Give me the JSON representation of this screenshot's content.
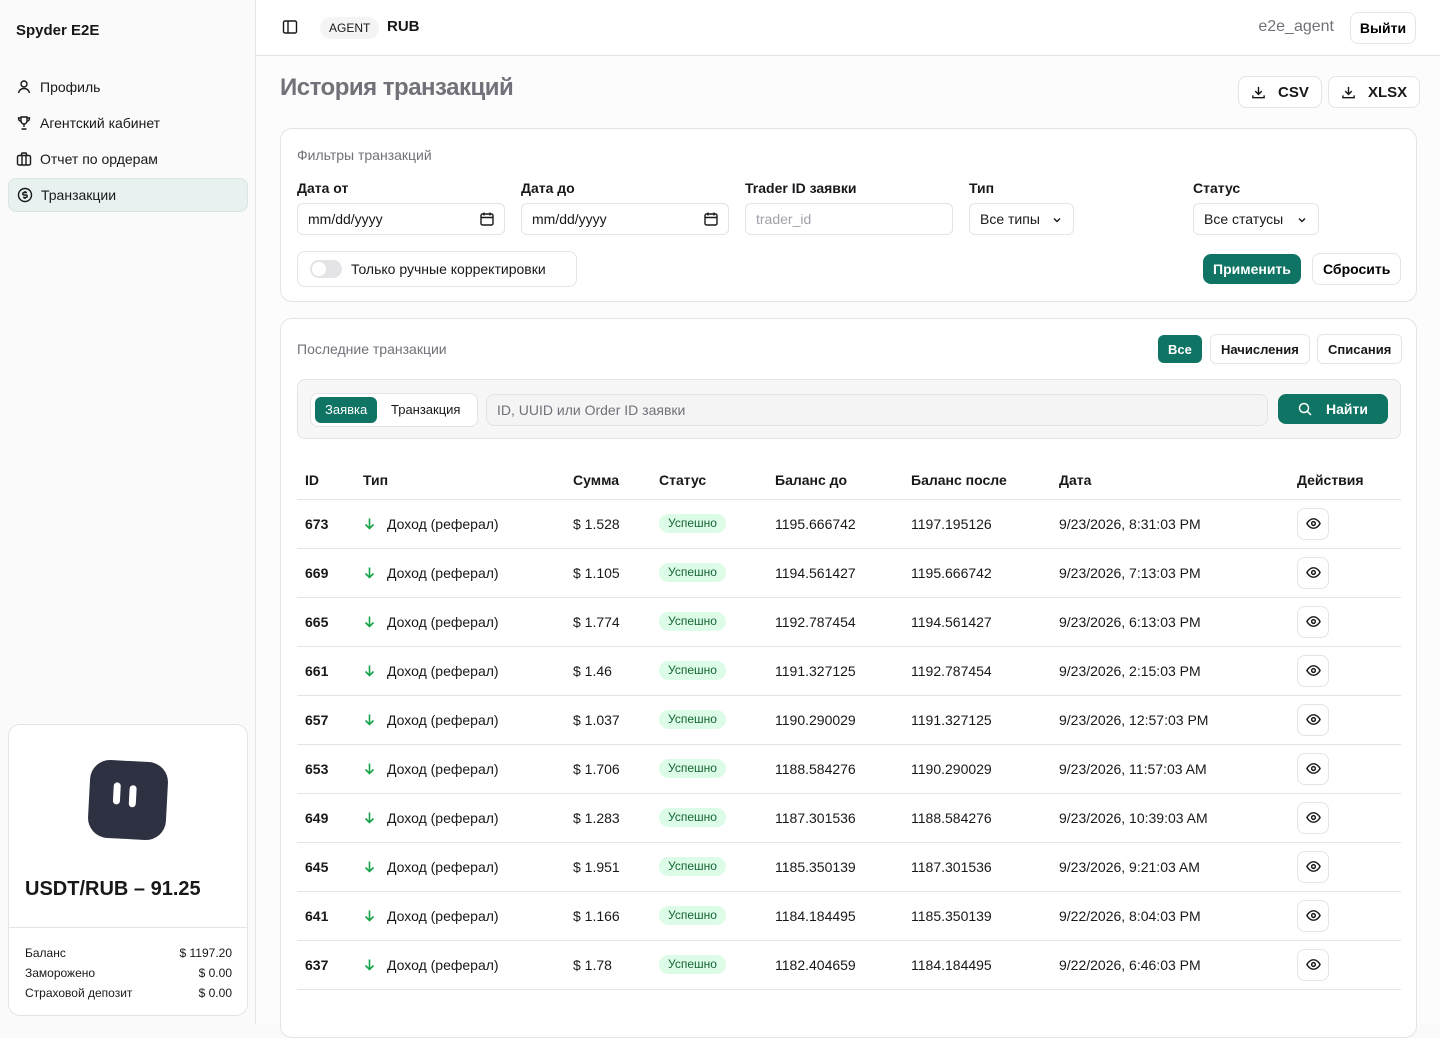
{
  "sidebar": {
    "brand": "Spyder E2E",
    "items": [
      {
        "label": "Профиль"
      },
      {
        "label": "Агентский кабинет"
      },
      {
        "label": "Отчет по ордерам"
      },
      {
        "label": "Транзакции"
      }
    ],
    "card": {
      "rate": "USDT/RUB – 91.25",
      "stats": [
        {
          "label": "Баланс",
          "value": "$ 1197.20"
        },
        {
          "label": "Заморожено",
          "value": "$ 0.00"
        },
        {
          "label": "Страховой депозит",
          "value": "$ 0.00"
        }
      ]
    }
  },
  "header": {
    "role": "AGENT",
    "currency": "RUB",
    "username": "e2e_agent",
    "logout": "Выйти"
  },
  "page": {
    "title": "История транзакций",
    "export_csv": "CSV",
    "export_xlsx": "XLSX"
  },
  "filters": {
    "title": "Фильтры транзакций",
    "date_from_label": "Дата от",
    "date_from_value": "mm/dd/yyyy",
    "date_to_label": "Дата до",
    "date_to_value": "mm/dd/yyyy",
    "trader_label": "Trader ID заявки",
    "trader_placeholder": "trader_id",
    "type_label": "Тип",
    "type_value": "Все типы",
    "status_label": "Статус",
    "status_value": "Все статусы",
    "manual_only": "Только ручные корректировки",
    "apply": "Применить",
    "reset": "Сбросить"
  },
  "recent": {
    "title": "Последние транзакции",
    "tabs": [
      "Все",
      "Начисления",
      "Списания"
    ],
    "search_modes": [
      "Заявка",
      "Транзакция"
    ],
    "search_placeholder": "ID, UUID или Order ID заявки",
    "find": "Найти",
    "columns": [
      "ID",
      "Тип",
      "Сумма",
      "Статус",
      "Баланс до",
      "Баланс после",
      "Дата",
      "Действия"
    ],
    "rows": [
      {
        "id": "673",
        "type": "Доход (реферал)",
        "amount": "$ 1.528",
        "status": "Успешно",
        "before": "1195.666742",
        "after": "1197.195126",
        "date": "9/23/2026, 8:31:03 PM"
      },
      {
        "id": "669",
        "type": "Доход (реферал)",
        "amount": "$ 1.105",
        "status": "Успешно",
        "before": "1194.561427",
        "after": "1195.666742",
        "date": "9/23/2026, 7:13:03 PM"
      },
      {
        "id": "665",
        "type": "Доход (реферал)",
        "amount": "$ 1.774",
        "status": "Успешно",
        "before": "1192.787454",
        "after": "1194.561427",
        "date": "9/23/2026, 6:13:03 PM"
      },
      {
        "id": "661",
        "type": "Доход (реферал)",
        "amount": "$ 1.46",
        "status": "Успешно",
        "before": "1191.327125",
        "after": "1192.787454",
        "date": "9/23/2026, 2:15:03 PM"
      },
      {
        "id": "657",
        "type": "Доход (реферал)",
        "amount": "$ 1.037",
        "status": "Успешно",
        "before": "1190.290029",
        "after": "1191.327125",
        "date": "9/23/2026, 12:57:03 PM"
      },
      {
        "id": "653",
        "type": "Доход (реферал)",
        "amount": "$ 1.706",
        "status": "Успешно",
        "before": "1188.584276",
        "after": "1190.290029",
        "date": "9/23/2026, 11:57:03 AM"
      },
      {
        "id": "649",
        "type": "Доход (реферал)",
        "amount": "$ 1.283",
        "status": "Успешно",
        "before": "1187.301536",
        "after": "1188.584276",
        "date": "9/23/2026, 10:39:03 AM"
      },
      {
        "id": "645",
        "type": "Доход (реферал)",
        "amount": "$ 1.951",
        "status": "Успешно",
        "before": "1185.350139",
        "after": "1187.301536",
        "date": "9/23/2026, 9:21:03 AM"
      },
      {
        "id": "641",
        "type": "Доход (реферал)",
        "amount": "$ 1.166",
        "status": "Успешно",
        "before": "1184.184495",
        "after": "1185.350139",
        "date": "9/22/2026, 8:04:03 PM"
      },
      {
        "id": "637",
        "type": "Доход (реферал)",
        "amount": "$ 1.78",
        "status": "Успешно",
        "before": "1182.404659",
        "after": "1184.184495",
        "date": "9/22/2026, 6:46:03 PM"
      }
    ]
  },
  "colors": {
    "accent": "#0f7464",
    "status_bg": "#dcfce7",
    "status_text": "#166534",
    "income_arrow": "#16a34a"
  }
}
